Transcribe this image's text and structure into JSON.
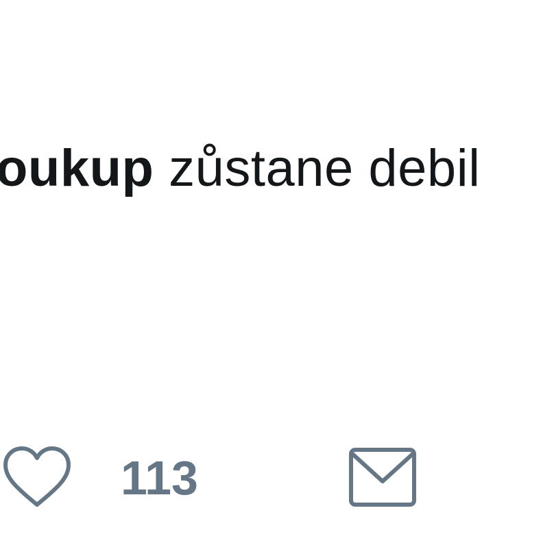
{
  "tweet": {
    "username": "oukup",
    "text": " zůstane debil"
  },
  "actions": {
    "like_icon": "heart-icon",
    "like_count": "113",
    "message_icon": "envelope-icon"
  },
  "colors": {
    "text": "#14171a",
    "icon": "#657786",
    "background": "#ffffff"
  }
}
